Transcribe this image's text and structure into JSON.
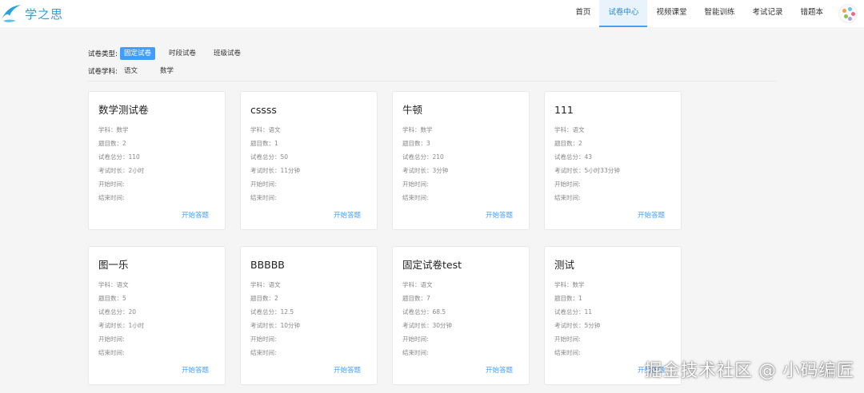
{
  "header": {
    "logo_text": "学之思",
    "nav": [
      {
        "label": "首页",
        "active": false
      },
      {
        "label": "试卷中心",
        "active": true
      },
      {
        "label": "视频课堂",
        "active": false
      },
      {
        "label": "智能训练",
        "active": false
      },
      {
        "label": "考试记录",
        "active": false
      },
      {
        "label": "错题本",
        "active": false
      }
    ]
  },
  "filter": {
    "type_label": "试卷类型:",
    "types": [
      {
        "label": "固定试卷",
        "active": true
      },
      {
        "label": "时段试卷",
        "active": false
      },
      {
        "label": "班级试卷",
        "active": false
      }
    ],
    "subject_label": "试卷学科:",
    "subjects": [
      {
        "label": "语文"
      },
      {
        "label": "数学"
      }
    ]
  },
  "labels": {
    "subject": "学科：",
    "question_count": "题目数：",
    "total_score": "试卷总分：",
    "duration": "考试时长：",
    "start_time": "开始时间:",
    "end_time": "结束时间:",
    "start_button": "开始答题"
  },
  "papers": [
    {
      "title": "数学测试卷",
      "subject": "数学",
      "count": "2",
      "score": "110",
      "duration": "2小时"
    },
    {
      "title": "cssss",
      "subject": "语文",
      "count": "1",
      "score": "50",
      "duration": "11分钟"
    },
    {
      "title": "牛顿",
      "subject": "数学",
      "count": "3",
      "score": "210",
      "duration": "3分钟"
    },
    {
      "title": "111",
      "subject": "语文",
      "count": "2",
      "score": "43",
      "duration": "5小时33分钟"
    },
    {
      "title": "图一乐",
      "subject": "语文",
      "count": "5",
      "score": "20",
      "duration": "1小时"
    },
    {
      "title": "BBBBB",
      "subject": "语文",
      "count": "2",
      "score": "12.5",
      "duration": "10分钟"
    },
    {
      "title": "固定试卷test",
      "subject": "语文",
      "count": "7",
      "score": "68.5",
      "duration": "30分钟"
    },
    {
      "title": "测试",
      "subject": "数学",
      "count": "1",
      "score": "11",
      "duration": "5分钟"
    }
  ],
  "watermark": "掘金技术社区 @ 小码编匠",
  "colors": {
    "accent": "#409eff",
    "logo": "#2aa1d8",
    "nav_active_bg": "#e8f3fc"
  }
}
